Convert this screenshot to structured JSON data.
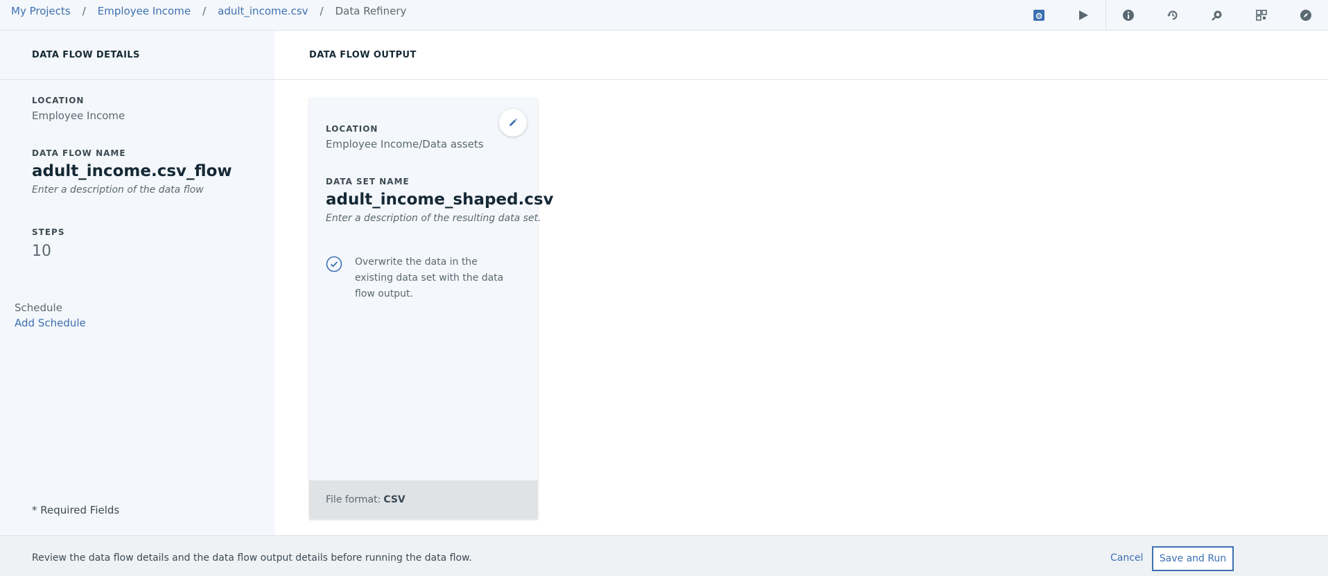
{
  "breadcrumb": {
    "items": [
      "My Projects",
      "Employee Income",
      "adult_income.csv"
    ],
    "current": "Data Refinery",
    "separator": "/"
  },
  "toolbar": {
    "icons": [
      "settings-icon",
      "run-icon",
      "info-icon",
      "schedule-icon",
      "search-replace-icon",
      "grid-icon",
      "compass-icon"
    ]
  },
  "details": {
    "header": "DATA FLOW DETAILS",
    "location_label": "LOCATION",
    "location_value": "Employee Income",
    "flow_name_label": "DATA FLOW NAME",
    "flow_name_value": "adult_income.csv_flow",
    "flow_description_placeholder": "Enter a description of the data flow",
    "steps_label": "STEPS",
    "steps_value": "10",
    "schedule_label": "Schedule",
    "add_schedule_link": "Add Schedule",
    "required_note": "* Required Fields"
  },
  "output": {
    "header": "DATA FLOW OUTPUT",
    "location_label": "LOCATION",
    "location_value": "Employee Income/Data assets",
    "dataset_name_label": "DATA SET NAME",
    "dataset_name_value": "adult_income_shaped.csv",
    "dataset_description_placeholder": "Enter a description of the resulting data set.",
    "overwrite_text": "Overwrite the data in the existing data set with the data flow output.",
    "file_format_label": "File format:",
    "file_format_value": "CSV"
  },
  "footer": {
    "message": "Review the data flow details and the data flow output details before running the data flow.",
    "cancel_label": "Cancel",
    "save_run_label": "Save and Run"
  },
  "colors": {
    "link": "#3d70b2",
    "panel_bg": "#f4f7fb",
    "text_dark": "#152935",
    "text_muted": "#5a6872"
  }
}
